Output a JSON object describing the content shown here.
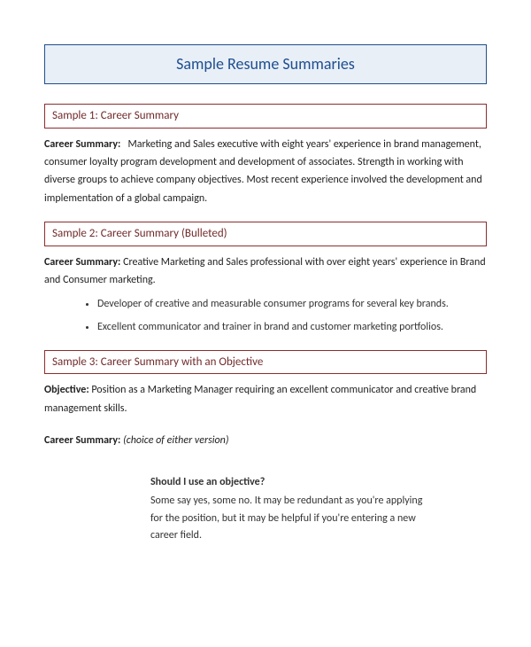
{
  "title": "Sample Resume Summaries",
  "samples": [
    {
      "header": "Sample 1: Career Summary",
      "label": "Career Summary:",
      "text": "Marketing and Sales executive with eight years' experience in brand management, consumer loyalty program development and development of associates. Strength in working with diverse groups to achieve company objectives. Most recent experience involved the development and implementation of a global campaign."
    },
    {
      "header": "Sample 2: Career Summary (Bulleted)",
      "label": "Career Summary:",
      "text": "Creative Marketing and Sales professional with over eight years' experience in Brand and Consumer marketing.",
      "bullets": [
        "Developer of creative and measurable consumer programs for several key brands.",
        "Excellent communicator and trainer in brand and customer marketing portfolios."
      ]
    },
    {
      "header": "Sample 3: Career Summary with an Objective",
      "label": "Objective:",
      "text": "Position as a Marketing Manager requiring an excellent communicator and creative brand management skills.",
      "label2": "Career Summary:",
      "text2": "(choice of either version)"
    }
  ],
  "callout": {
    "title": "Should I use an objective?",
    "body": "Some say yes, some no. It may be redundant as you're applying for the position, but it may be helpful if you're entering a new career field."
  }
}
